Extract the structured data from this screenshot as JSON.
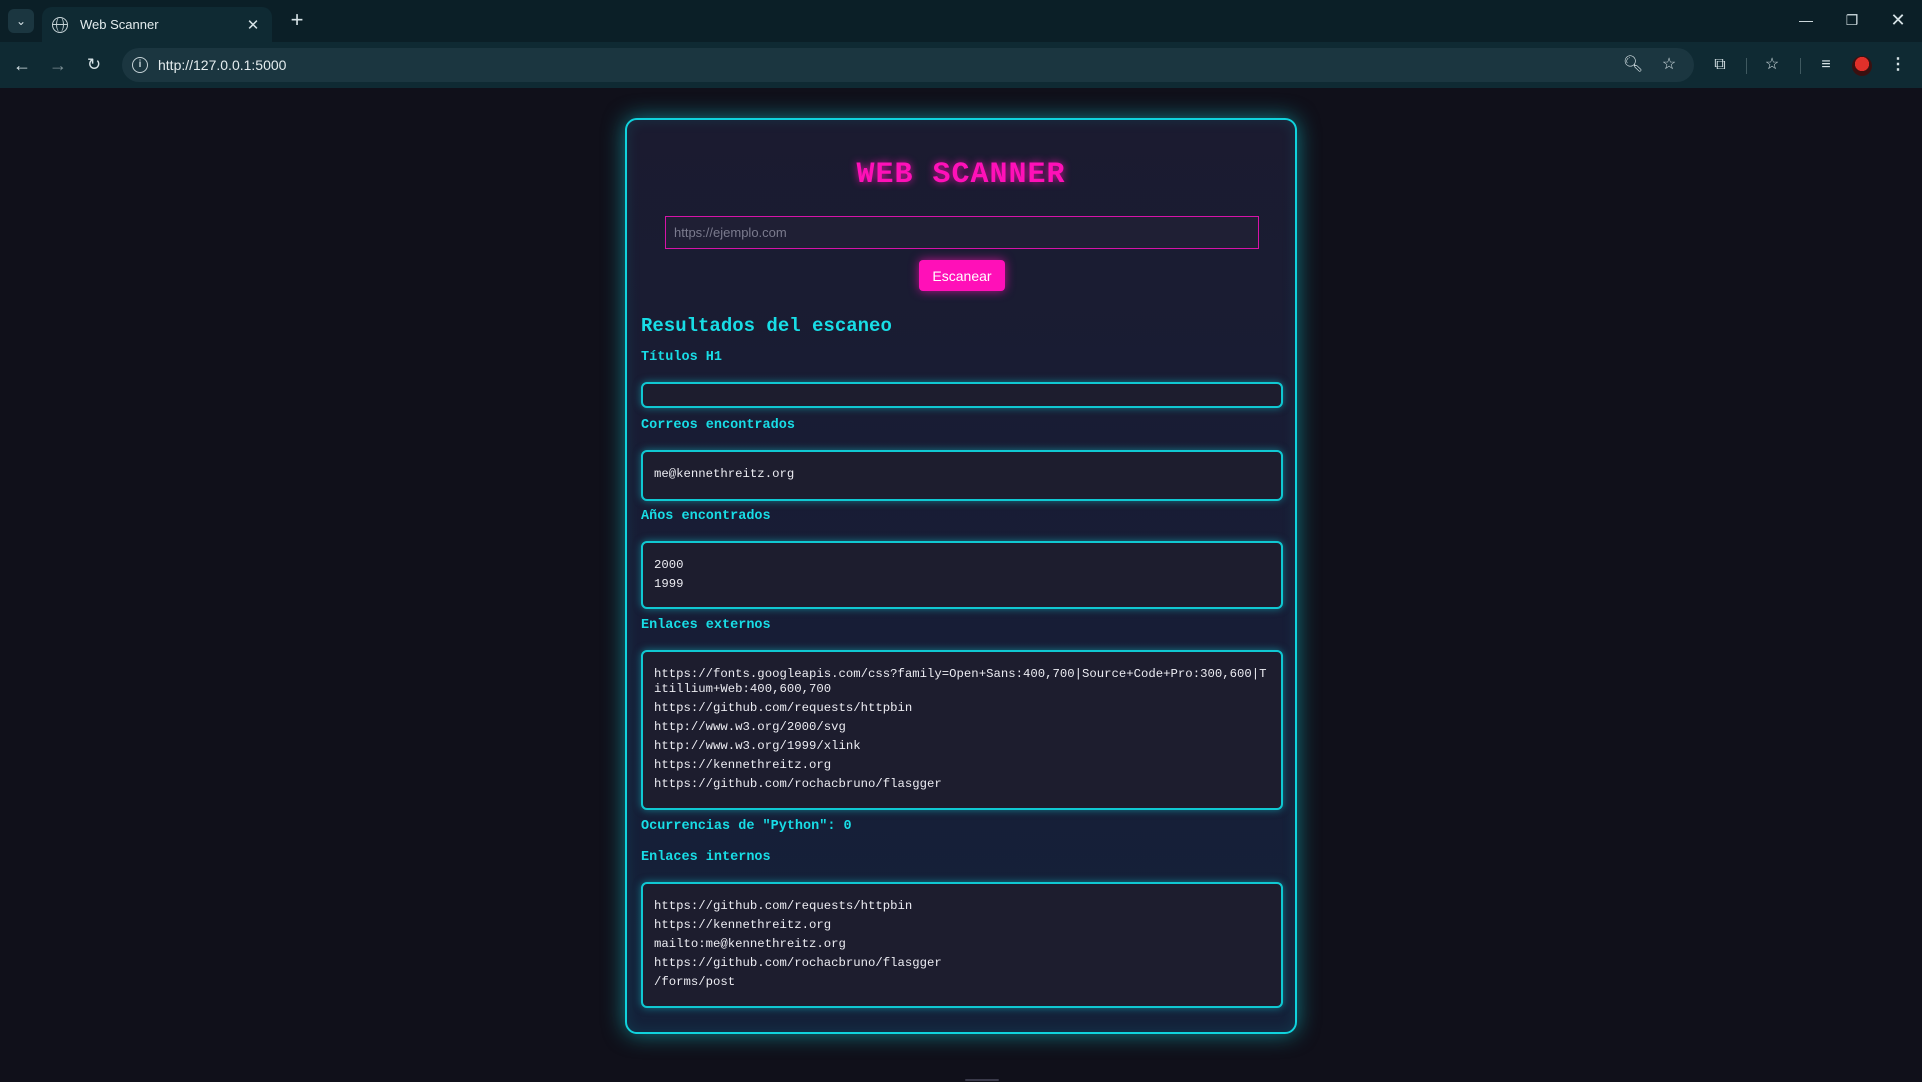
{
  "browser": {
    "tab_title": "Web Scanner",
    "url": "http://127.0.0.1:5000",
    "icons": {
      "tab_search": "chevron-down-icon",
      "favicon": "globe-icon",
      "tab_close": "close-icon",
      "new_tab": "plus-icon",
      "back": "arrow-left-icon",
      "forward": "arrow-right-icon",
      "reload": "reload-icon",
      "site_info": "info-icon",
      "zoom": "zoom-icon",
      "bookmark": "star-icon",
      "extensions": "puzzle-icon",
      "favorites": "favorites-icon",
      "media": "media-control-icon",
      "menu": "kebab-menu-icon"
    }
  },
  "app": {
    "title": "WEB SCANNER",
    "url_placeholder": "https://ejemplo.com",
    "url_value": "",
    "scan_button": "Escanear",
    "results_heading": "Resultados del escaneo",
    "colors": {
      "accent_cyan": "#10d3dd",
      "accent_pink": "#ff10b8",
      "background": "#10101a"
    }
  },
  "results": {
    "h1": {
      "label": "Títulos H1",
      "items": []
    },
    "emails": {
      "label": "Correos encontrados",
      "items": [
        "me@kennethreitz.org"
      ]
    },
    "years": {
      "label": "Años encontrados",
      "items": [
        "2000",
        "1999"
      ]
    },
    "external_links": {
      "label": "Enlaces externos",
      "items": [
        "https://fonts.googleapis.com/css?family=Open+Sans:400,700|Source+Code+Pro:300,600|Titillium+Web:400,600,700",
        "https://github.com/requests/httpbin",
        "http://www.w3.org/2000/svg",
        "http://www.w3.org/1999/xlink",
        "https://kennethreitz.org",
        "https://github.com/rochacbruno/flasgger"
      ]
    },
    "python_count": {
      "label": "Ocurrencias de \"Python\": 0"
    },
    "internal_links": {
      "label": "Enlaces internos",
      "items": [
        "https://github.com/requests/httpbin",
        "https://kennethreitz.org",
        "mailto:me@kennethreitz.org",
        "https://github.com/rochacbruno/flasgger",
        "/forms/post"
      ]
    }
  }
}
